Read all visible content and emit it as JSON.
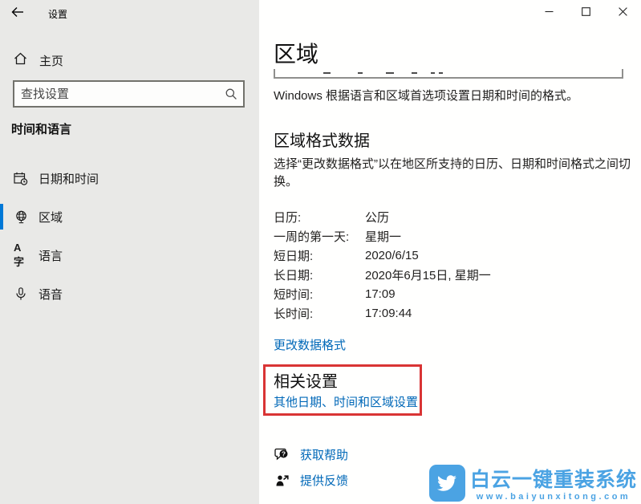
{
  "window": {
    "title": "设置"
  },
  "sidebar": {
    "home_label": "主页",
    "search_placeholder": "查找设置",
    "section_title": "时间和语言",
    "items": [
      {
        "label": "日期和时间",
        "icon": "calendar-clock-icon",
        "selected": false
      },
      {
        "label": "区域",
        "icon": "globe-icon",
        "selected": true
      },
      {
        "label": "语言",
        "icon": "language-icon",
        "selected": false
      },
      {
        "label": "语音",
        "icon": "microphone-icon",
        "selected": false
      }
    ],
    "language_icon_glyph": "A字"
  },
  "main": {
    "page_title": "区域",
    "intro": "Windows 根据语言和区域首选项设置日期和时间的格式。",
    "format_section": {
      "title": "区域格式数据",
      "description": "选择“更改数据格式”以在地区所支持的日历、日期和时间格式之间切换。",
      "rows": [
        {
          "label": "日历:",
          "value": "公历"
        },
        {
          "label": "一周的第一天:",
          "value": "星期一"
        },
        {
          "label": "短日期:",
          "value": "2020/6/15"
        },
        {
          "label": "长日期:",
          "value": "2020年6月15日, 星期一"
        },
        {
          "label": "短时间:",
          "value": "17:09"
        },
        {
          "label": "长时间:",
          "value": "17:09:44"
        }
      ],
      "change_link": "更改数据格式"
    },
    "related": {
      "title": "相关设置",
      "link": "其他日期、时间和区域设置",
      "highlight_color": "#d93434"
    },
    "help_link": "获取帮助",
    "feedback_link": "提供反馈"
  },
  "watermark": {
    "title": "白云一键重装系统",
    "url": "www.baiyunxitong.com",
    "brand_color": "#4ba3e3"
  },
  "colors": {
    "accent": "#0078d7",
    "link": "#0068b8",
    "sidebar_bg": "#e9e9e7"
  }
}
